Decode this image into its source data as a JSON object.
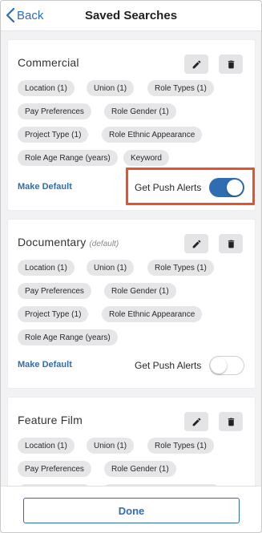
{
  "header": {
    "back_label": "Back",
    "title": "Saved Searches"
  },
  "accent_color": "#2f6db3",
  "highlight_color": "#e5532d",
  "cards": [
    {
      "title": "Commercial",
      "default_tag": "",
      "chips": [
        "Location (1)",
        "Union (1)",
        "Role Types (1)",
        "Pay Preferences",
        "Role Gender (1)",
        "Project Type (1)",
        "Role Ethnic Appearance",
        "Role Age Range (years)",
        "Keyword"
      ],
      "make_default_label": "Make Default",
      "push_label": "Get Push Alerts",
      "push_enabled": true
    },
    {
      "title": "Documentary",
      "default_tag": "(default)",
      "chips": [
        "Location (1)",
        "Union (1)",
        "Role Types (1)",
        "Pay Preferences",
        "Role Gender (1)",
        "Project Type (1)",
        "Role Ethnic Appearance",
        "Role Age Range (years)"
      ],
      "make_default_label": "Make Default",
      "push_label": "Get Push Alerts",
      "push_enabled": false
    },
    {
      "title": "Feature Film",
      "default_tag": "",
      "chips": [
        "Location (1)",
        "Union (1)",
        "Role Types (1)",
        "Pay Preferences",
        "Role Gender (1)"
      ]
    }
  ],
  "footer": {
    "done_label": "Done"
  },
  "icons": {
    "back": "chevron-left-icon",
    "edit": "pencil-icon",
    "delete": "trash-icon"
  }
}
